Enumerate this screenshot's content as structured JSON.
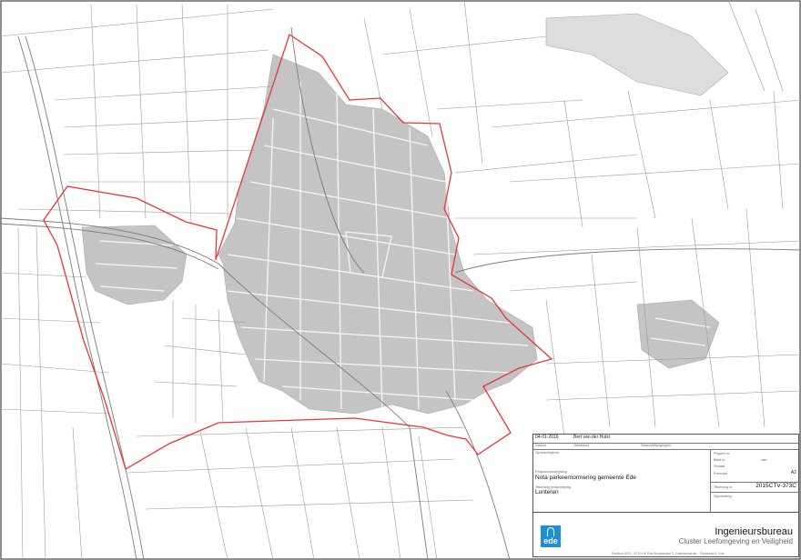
{
  "map": {
    "boundary_color": "#e8343a",
    "line_color": "#9a9a9a",
    "builtup_color": "#bdbdbd"
  },
  "title_block": {
    "date": "04-01-2016",
    "author": "Bert van der Hulst",
    "date_label": "Datum",
    "drawn_label": "Getekend",
    "checked_label": "Gecontroleerd",
    "check_label": "Status/Wijzigingen",
    "client_label": "Opdrachtgever",
    "project_label": "Projectomschrijving",
    "project": "Nota parkeernormering gemeente Ede",
    "drawing_label": "Tekening omschrijving",
    "drawing": "Lunteren",
    "project_nr_label": "Project nr.",
    "sheet_nr_label": "Blad nr.",
    "sheet_nr": "van",
    "scale_label": "Schaal",
    "format_label": "Formaat",
    "format": "A2",
    "drawing_nr_label": "Tekening nr.",
    "drawing_nr": "2015CTV-373C",
    "notes_label": "Opmerking",
    "brand_title": "Ingenieursbureau",
    "brand_subtitle": "Cluster Leefomgeving en Veiligheid",
    "logo_text": "ede",
    "logo_color": "#1f8fcf",
    "footer": "Postbus 9022 - 6710 HK Ede    Bergsebaan 2, Galeriekwartier - Postadres 6, Ede"
  }
}
